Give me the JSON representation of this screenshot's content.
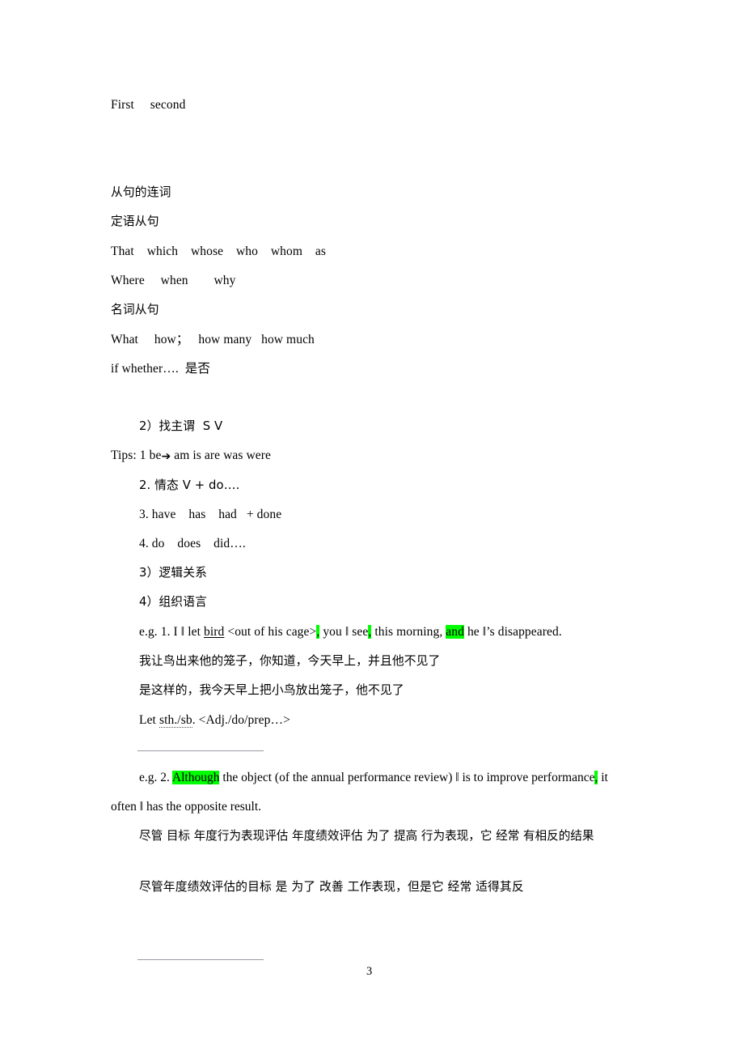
{
  "document": {
    "page_number": "3",
    "highlight_color": "#00ff00",
    "rule_color": "#9a9aa5"
  },
  "lines": {
    "first_second": "First     second",
    "conj_heading": "从句的连词",
    "attributive_heading": "定语从句",
    "attributive_list_1": "That    which    whose    who    whom    as",
    "attributive_list_2": "Where     when        why",
    "noun_clause_heading": "名词从句",
    "noun_clause_list_1": "What     how；   how many   how much",
    "noun_clause_list_2": "if whether….  是否",
    "item2": "2）找主谓  S V",
    "tips_prefix": "Tips: 1 be",
    "tips_arrow": "➔",
    "tips_suffix": " am is are was were",
    "tips_2": "2. 情态 V + do….",
    "tips_3": "3. have    has    had   + done",
    "tips_4": "4. do    does    did….",
    "item3": "3）逻辑关系",
    "item4": "4）组织语言"
  },
  "example_1": {
    "prefix": "e.g. 1. I ‖ let ",
    "underlined_word": "bird",
    "mid_1": " <out of his cage>",
    "hl_1": ",",
    "mid_2": " you ‖ see",
    "hl_2": ",",
    "mid_3": " this morning, ",
    "hl_3": "and",
    "suffix": " he ‖’s disappeared.",
    "translation_1": "我让鸟出来他的笼子，你知道，今天早上，并且他不见了",
    "translation_2": "是这样的，我今天早上把小鸟放出笼子，他不见了",
    "pattern_prefix": "Let ",
    "pattern_spell": "sth./sb",
    "pattern_suffix": ". <Adj./do/prep…>"
  },
  "example_2": {
    "prefix": "e.g. 2. ",
    "hl_1": "Although",
    "mid_1": " the object (of the annual performance review) ‖ is to improve performance",
    "hl_2": ",",
    "suffix": " it often ‖ has the opposite result.",
    "translation_1": "尽管 目标 年度行为表现评估 年度绩效评估 为了  提高 行为表现，它 经常 有相反的结果",
    "translation_2": "尽管年度绩效评估的目标 是 为了 改善 工作表现，但是它 经常 适得其反"
  }
}
